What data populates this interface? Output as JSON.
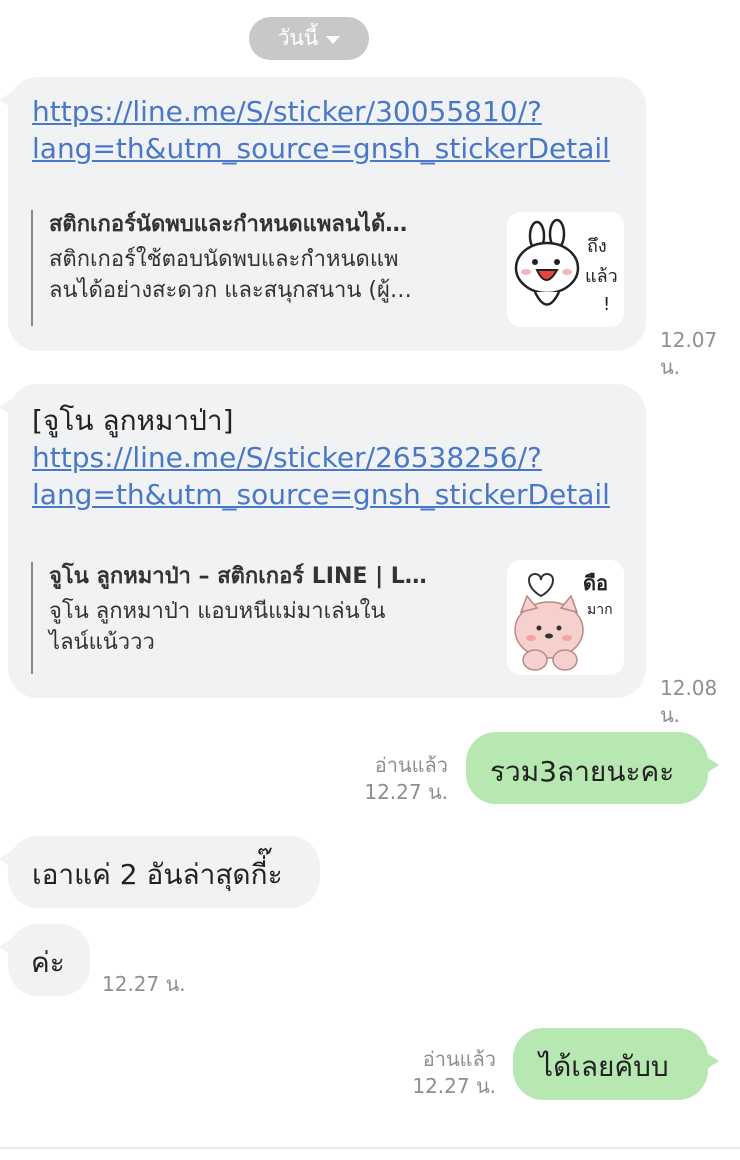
{
  "date_pill": {
    "label": "วันนี้"
  },
  "messages": [
    {
      "link": "https://line.me/S/sticker/30055810/?lang=th&utm_source=gnsh_stickerDetail",
      "link_line1": "https://line.me/S/sticker/30055810/?",
      "link_line2": "lang=th&utm_source=gnsh_stickerDetail",
      "preview_title": "สติกเกอร์นัดพบและกำหนดแพลนได้…",
      "preview_desc_line1": "สติกเกอร์ใช้ตอบนัดพบและกำหนดแพ",
      "preview_desc_line2": "ลนได้อย่างสะดวก และสนุกสนาน (ผู้…",
      "thumb_text_1": "ถึง",
      "thumb_text_2": "แล้ว",
      "thumb_text_3": "!",
      "time": "12.07 น."
    },
    {
      "prefix": "[จูโน ลูกหมาป่า]",
      "link": "https://line.me/S/sticker/26538256/?lang=th&utm_source=gnsh_stickerDetail",
      "link_line1": "https://line.me/S/sticker/26538256/?",
      "link_line2": "lang=th&utm_source=gnsh_stickerDetail",
      "preview_title": "จูโน ลูกหมาป่า – สติกเกอร์ LINE | L…",
      "preview_desc_line1": "จูโน ลูกหมาป่า แอบหนีแม่มาเล่นใน",
      "preview_desc_line2": "ไลน์แน้ววว",
      "thumb_text_1": "ดือ",
      "thumb_text_2": "มาก",
      "time": "12.08 น."
    },
    {
      "text": "รวม3ลายนะคะ",
      "read": "อ่านแล้ว",
      "time": "12.27 น."
    },
    {
      "text": "เอาแค่ 2 อันล่าสุดกี่๊ะ"
    },
    {
      "text": "ค่ะ",
      "time": "12.27 น."
    },
    {
      "text": "ได้เลยคับบ",
      "read": "อ่านแล้ว",
      "time": "12.27 น."
    }
  ],
  "colors": {
    "incoming_bubble": "#f1f2f4",
    "outgoing_bubble": "#b7e8b1",
    "link": "#4a78c8",
    "date_pill": "#c8c8ca"
  }
}
